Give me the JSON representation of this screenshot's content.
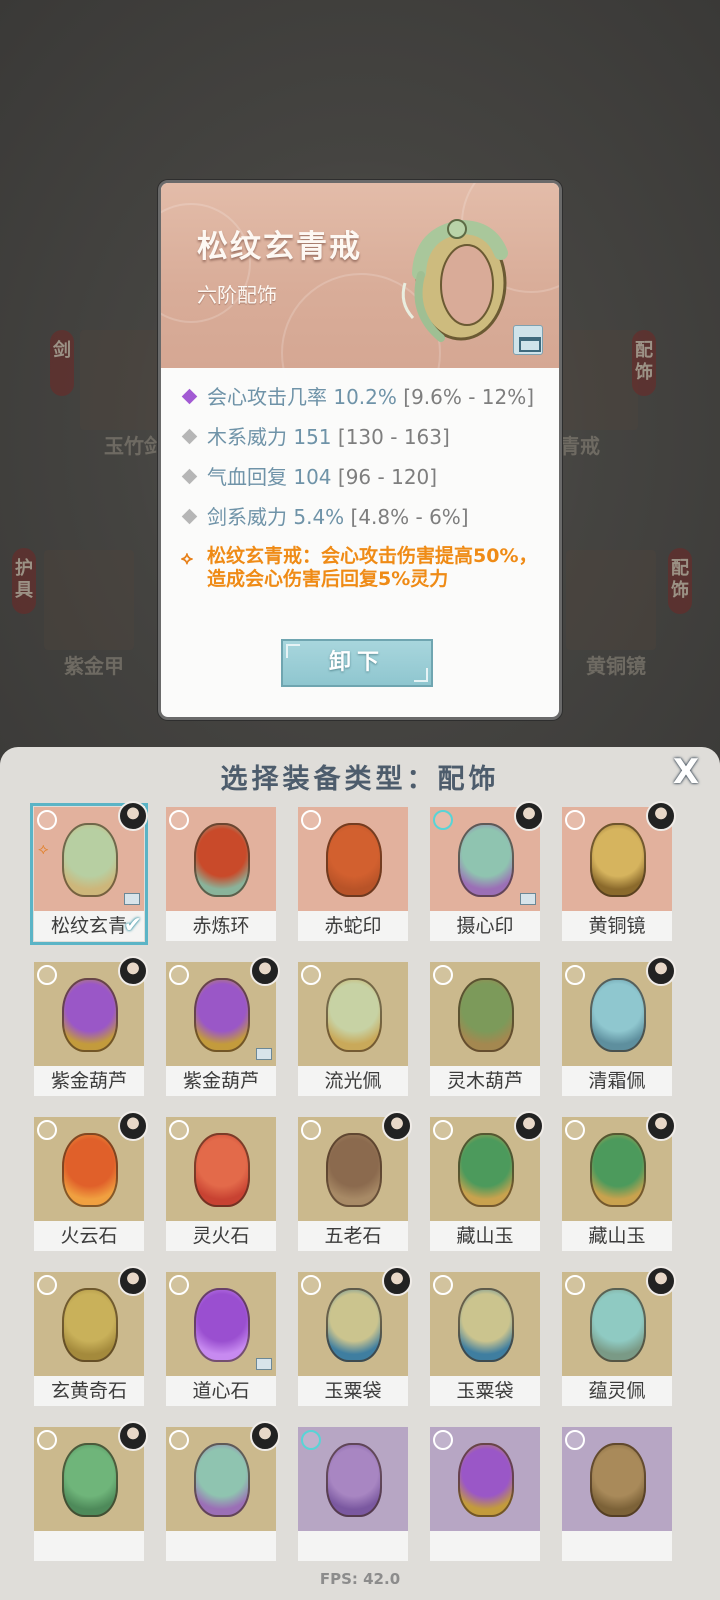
{
  "background": {
    "tags": [
      "剑",
      "配饰",
      "护具",
      "配饰"
    ],
    "labels": [
      "玉竹剑",
      "玄青戒",
      "紫金甲",
      "黄铜镜"
    ]
  },
  "detail": {
    "name": "松纹玄青戒",
    "tier": "六阶配饰",
    "icon": "jade-ring",
    "stats": [
      {
        "name": "会心攻击几率",
        "value": "10.2%",
        "range": "[9.6% - 12%]",
        "rarity": "purple"
      },
      {
        "name": "木系威力",
        "value": "151",
        "range": "[130 - 163]",
        "rarity": "normal"
      },
      {
        "name": "气血回复",
        "value": "104",
        "range": "[96 - 120]",
        "rarity": "normal"
      },
      {
        "name": "剑系威力",
        "value": "5.4%",
        "range": "[4.8% - 6%]",
        "rarity": "normal"
      }
    ],
    "set_bonus": "松纹玄青戒：会心攻击伤害提高50%，造成会心伤害后回复5%灵力",
    "unequip_label": "卸下"
  },
  "panel": {
    "title": "选择装备类型：配饰",
    "close_label": "X",
    "items": [
      {
        "name": "松纹玄青",
        "bg": "peach",
        "selected": true,
        "icon": "jade-ring",
        "avatar": true,
        "chest": true,
        "set": true
      },
      {
        "name": "赤炼环",
        "bg": "peach",
        "icon": "red-amulet"
      },
      {
        "name": "赤蛇印",
        "bg": "peach",
        "icon": "red-seal"
      },
      {
        "name": "摄心印",
        "bg": "peach",
        "icon": "teal-seal",
        "avatar": true,
        "chest": true,
        "teal": true
      },
      {
        "name": "黄铜镜",
        "bg": "peach",
        "icon": "brass-mirror",
        "avatar": true
      },
      {
        "name": "紫金葫芦",
        "bg": "tan",
        "icon": "purple-gourd",
        "avatar": true
      },
      {
        "name": "紫金葫芦",
        "bg": "tan",
        "icon": "purple-gourd",
        "avatar": true,
        "chest": true
      },
      {
        "name": "流光佩",
        "bg": "tan",
        "icon": "swirl-pendant"
      },
      {
        "name": "灵木葫芦",
        "bg": "tan",
        "icon": "green-gourd"
      },
      {
        "name": "清霜佩",
        "bg": "tan",
        "icon": "frost-pendant",
        "avatar": true
      },
      {
        "name": "火云石",
        "bg": "tan",
        "icon": "fire-stone",
        "avatar": true
      },
      {
        "name": "灵火石",
        "bg": "tan",
        "icon": "flame-stone"
      },
      {
        "name": "五老石",
        "bg": "tan",
        "icon": "elder-stone",
        "avatar": true
      },
      {
        "name": "藏山玉",
        "bg": "tan",
        "icon": "jade-disc",
        "avatar": true
      },
      {
        "name": "藏山玉",
        "bg": "tan",
        "icon": "jade-disc",
        "avatar": true
      },
      {
        "name": "玄黄奇石",
        "bg": "tan",
        "icon": "gold-stone",
        "avatar": true
      },
      {
        "name": "道心石",
        "bg": "tan",
        "icon": "purple-orb",
        "chest": true
      },
      {
        "name": "玉粟袋",
        "bg": "tan",
        "icon": "herb-bag",
        "avatar": true
      },
      {
        "name": "玉粟袋",
        "bg": "tan",
        "icon": "herb-bag"
      },
      {
        "name": "蕴灵佩",
        "bg": "tan",
        "icon": "spirit-pendant",
        "avatar": true
      },
      {
        "name": "",
        "bg": "tan",
        "icon": "jade-carving",
        "avatar": true
      },
      {
        "name": "",
        "bg": "tan",
        "icon": "teal-seal",
        "avatar": true
      },
      {
        "name": "",
        "bg": "purple",
        "icon": "purple-vase",
        "teal": true
      },
      {
        "name": "",
        "bg": "purple",
        "icon": "purple-gourd"
      },
      {
        "name": "",
        "bg": "purple",
        "icon": "bronze-seal"
      }
    ]
  },
  "fps": "FPS: 42.0"
}
